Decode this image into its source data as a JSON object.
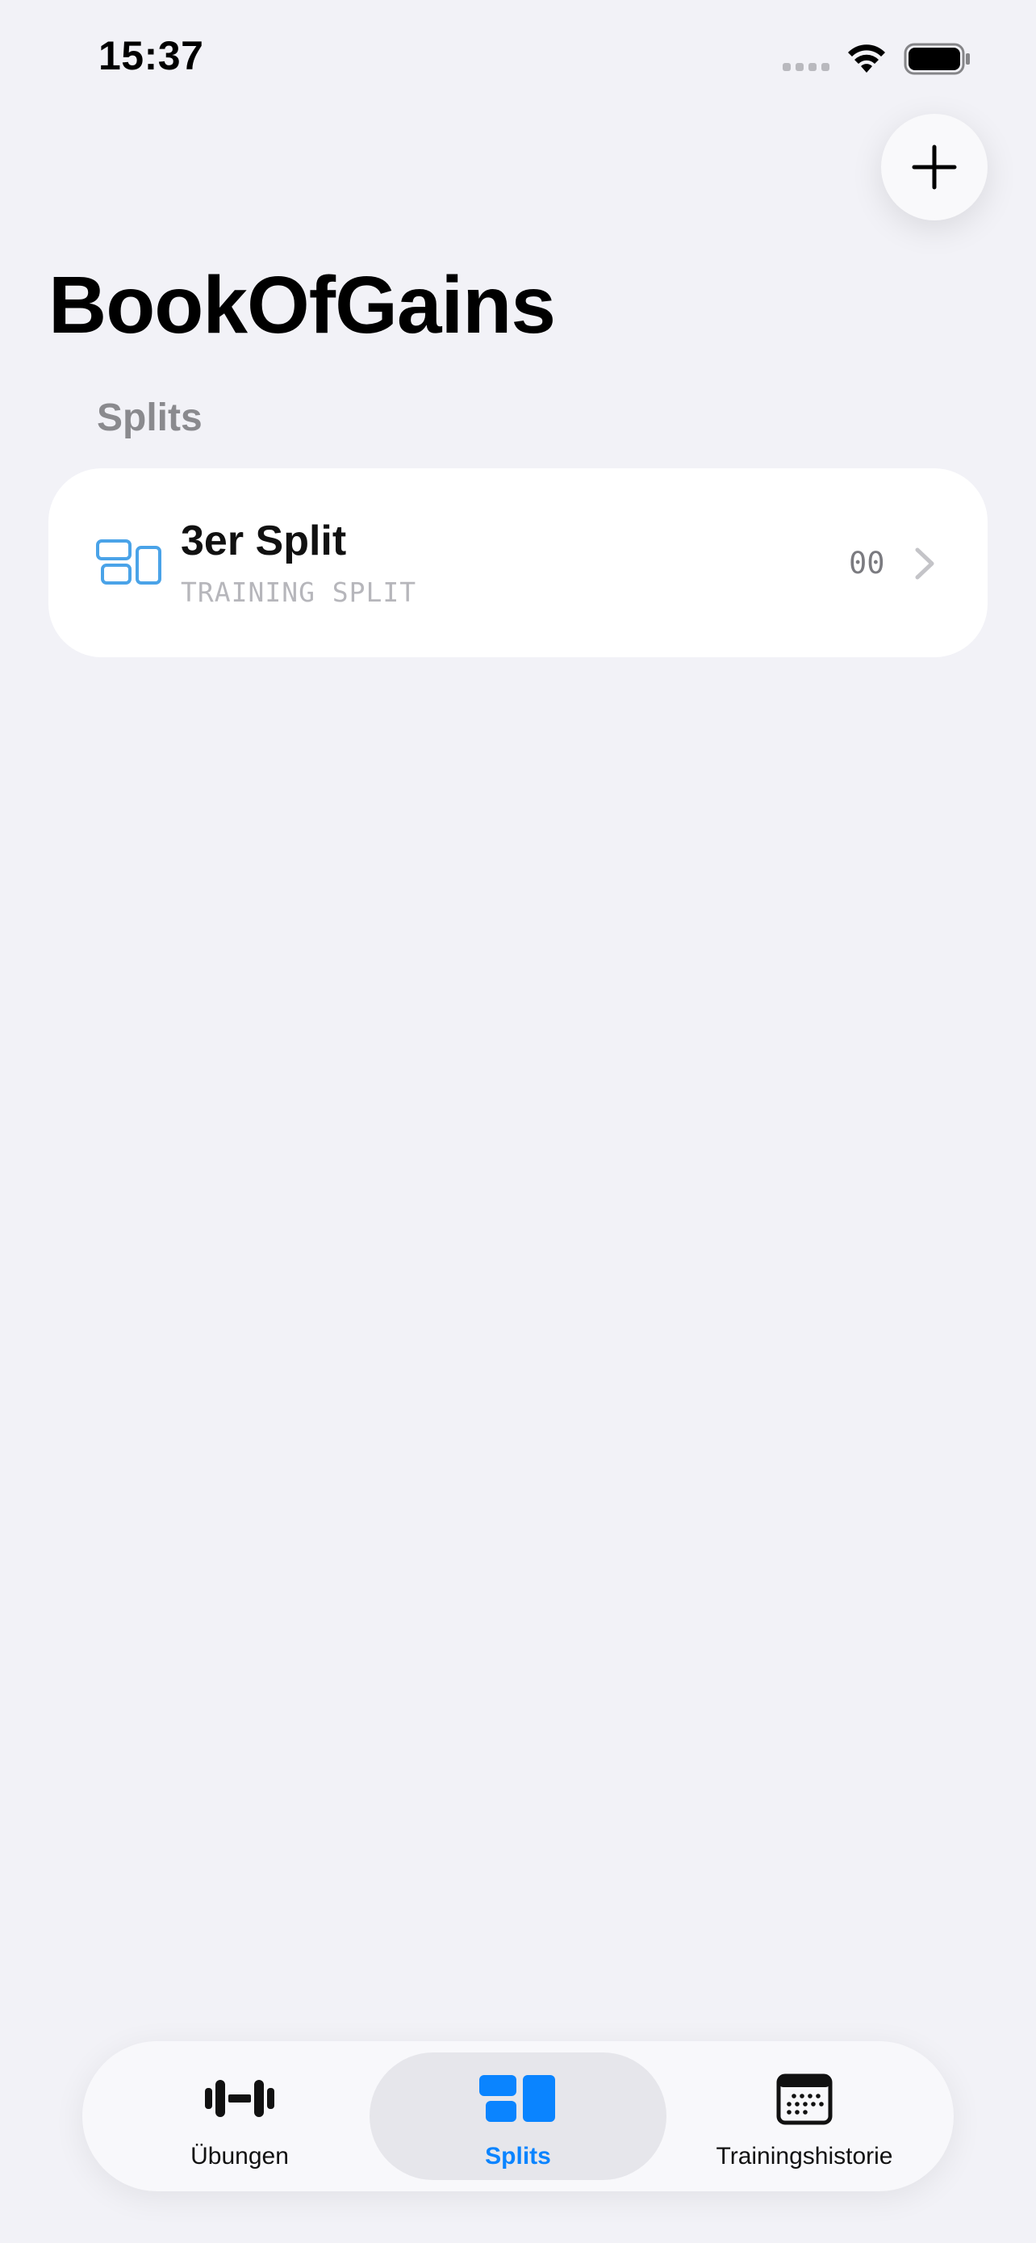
{
  "status_bar": {
    "time": "15:37"
  },
  "header": {
    "title": "BookOfGains",
    "add_button_icon": "plus-icon"
  },
  "section": {
    "title": "Splits"
  },
  "splits": [
    {
      "title": "3er Split",
      "subtitle": "TRAINING SPLIT",
      "count": "00",
      "icon": "split-icon"
    }
  ],
  "tabbar": {
    "tabs": [
      {
        "label": "Übungen",
        "icon": "dumbbell-icon",
        "selected": false
      },
      {
        "label": "Splits",
        "icon": "splits-icon",
        "selected": true
      },
      {
        "label": "Trainingshistorie",
        "icon": "calendar-icon",
        "selected": false
      }
    ]
  },
  "colors": {
    "accent": "#0a84ff",
    "background": "#f2f2f7",
    "card": "#ffffff",
    "secondary_text": "#8a8a8e"
  }
}
